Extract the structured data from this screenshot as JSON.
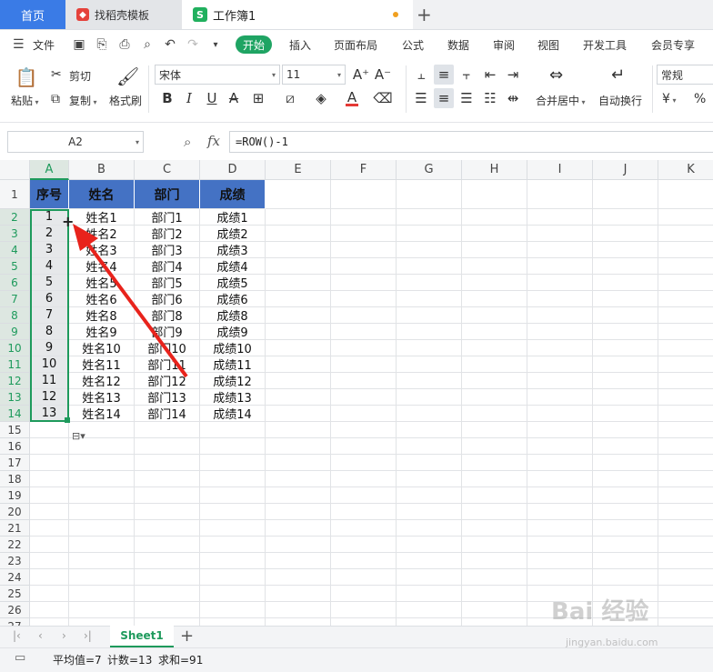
{
  "tabs": {
    "home": "首页",
    "template": "找稻壳模板",
    "workbook": "工作簿1"
  },
  "menu": {
    "file": "文件",
    "items": [
      "开始",
      "插入",
      "页面布局",
      "公式",
      "数据",
      "审阅",
      "视图",
      "开发工具",
      "会员专享"
    ]
  },
  "ribbon": {
    "paste": "粘贴",
    "cut": "剪切",
    "copy": "复制",
    "format_painter": "格式刷",
    "font_name": "宋体",
    "font_size": "11",
    "merge_center": "合并居中",
    "wrap_text": "自动换行",
    "number_format": "常规",
    "currency_symbol": "¥",
    "percent_symbol": "%",
    "font_size_up": "A⁺",
    "font_size_down": "A⁻",
    "bold": "B",
    "italic": "I",
    "underline": "U",
    "strike": "A",
    "font_color": "A",
    "accent_green": "#1fa463",
    "font_color_swatch": "#e53935"
  },
  "formula_bar": {
    "name_box": "A2",
    "fx_label": "fx",
    "formula": "=ROW()-1"
  },
  "grid": {
    "columns": [
      "A",
      "B",
      "C",
      "D",
      "E",
      "F",
      "G",
      "H",
      "I",
      "J",
      "K"
    ],
    "row_numbers": [
      "1",
      "2",
      "3",
      "4",
      "5",
      "6",
      "7",
      "8",
      "9",
      "10",
      "11",
      "12",
      "13",
      "14",
      "15",
      "16",
      "17",
      "18",
      "19",
      "20",
      "21",
      "22",
      "23",
      "24",
      "25",
      "26",
      "27"
    ],
    "header": [
      "序号",
      "姓名",
      "部门",
      "成绩"
    ],
    "rows": [
      [
        "1",
        "姓名1",
        "部门1",
        "成绩1"
      ],
      [
        "2",
        "姓名2",
        "部门2",
        "成绩2"
      ],
      [
        "3",
        "姓名3",
        "部门3",
        "成绩3"
      ],
      [
        "4",
        "姓名4",
        "部门4",
        "成绩4"
      ],
      [
        "5",
        "姓名5",
        "部门5",
        "成绩5"
      ],
      [
        "6",
        "姓名6",
        "部门6",
        "成绩6"
      ],
      [
        "7",
        "姓名8",
        "部门8",
        "成绩8"
      ],
      [
        "8",
        "姓名9",
        "部门9",
        "成绩9"
      ],
      [
        "9",
        "姓名10",
        "部门10",
        "成绩10"
      ],
      [
        "10",
        "姓名11",
        "部门11",
        "成绩11"
      ],
      [
        "11",
        "姓名12",
        "部门12",
        "成绩12"
      ],
      [
        "12",
        "姓名13",
        "部门13",
        "成绩13"
      ],
      [
        "13",
        "姓名14",
        "部门14",
        "成绩14"
      ]
    ],
    "header_fill": "#4472c4",
    "selection_color": "#1e9a5c",
    "arrow_color": "#e8231c"
  },
  "sheets": {
    "active": "Sheet1"
  },
  "status": {
    "average": "平均值=7",
    "count": "计数=13",
    "sum": "求和=91"
  },
  "watermark": {
    "brand": "Bai 经验",
    "url": "jingyan.baidu.com"
  }
}
